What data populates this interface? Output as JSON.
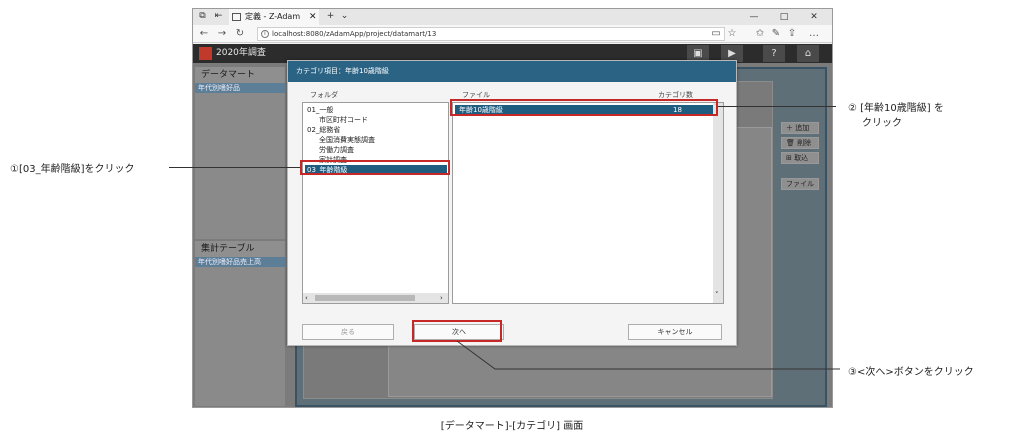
{
  "browser": {
    "tab_title": "定義 - Z-Adam",
    "url": "localhost:8080/zAdamApp/project/datamart/13"
  },
  "app": {
    "title": "2020年調査"
  },
  "background": {
    "datamart_title": "データマート",
    "datamart_item": "年代別嗜好品",
    "aggregate_title": "集計テーブル",
    "aggregate_item": "年代別嗜好品売上高",
    "buttons": {
      "add": "追加",
      "delete": "削除",
      "import": "取込",
      "file": "ファイル"
    }
  },
  "dialog": {
    "title": "カテゴリ項目：年齢10歳階級",
    "folder_label": "フォルダ",
    "file_label": "ファイル",
    "count_label": "カテゴリ数",
    "folders": [
      {
        "label": "01_一般",
        "indent": 0
      },
      {
        "label": "市区町村コード",
        "indent": 1
      },
      {
        "label": "02_総務省",
        "indent": 0
      },
      {
        "label": "全国消費実態調査",
        "indent": 1
      },
      {
        "label": "労働力調査",
        "indent": 1
      },
      {
        "label": "家計調査",
        "indent": 1
      },
      {
        "label": "03_年齢階級",
        "indent": 0,
        "selected": true
      }
    ],
    "file_row": {
      "name": "年齢10歳階級",
      "count": "18"
    },
    "back_button": "戻る",
    "next_button": "次へ",
    "cancel_button": "キャンセル"
  },
  "annotations": {
    "step1": "①[03_年齢階級]をクリック",
    "step2_line1": "② [年齢10歳階級] を",
    "step2_line2": "クリック",
    "step3": "③<次へ>ボタンをクリック",
    "caption": "[データマート]-[カテゴリ] 画面"
  },
  "colors": {
    "dialog_header": "#2b6384",
    "selection": "#1f5d80",
    "annotation_box": "#c62828"
  }
}
